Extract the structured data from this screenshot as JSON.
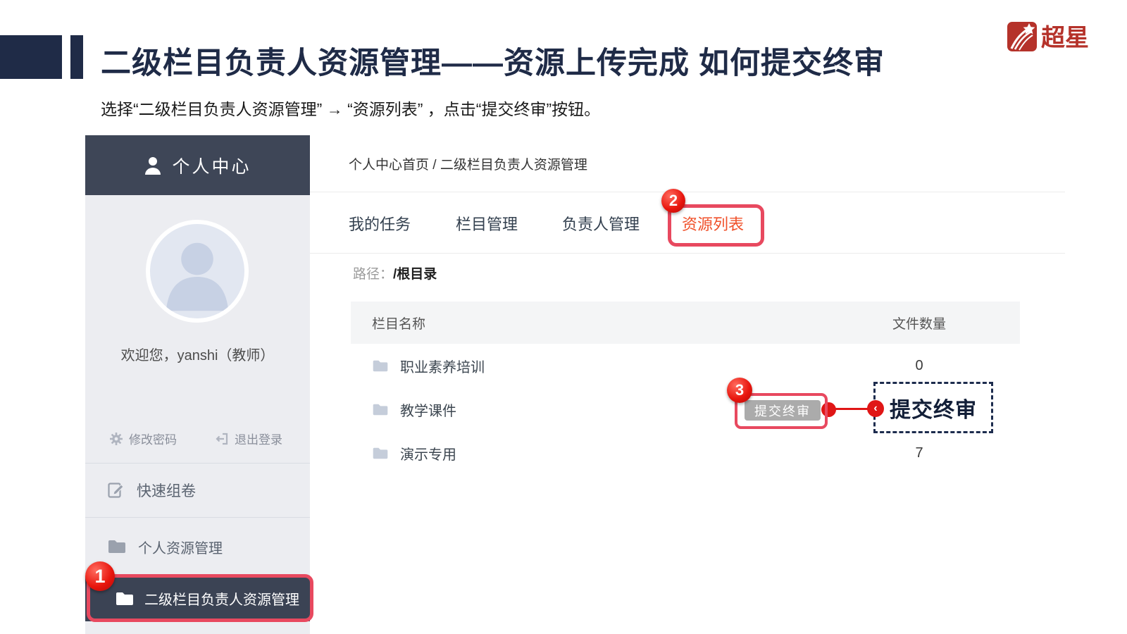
{
  "page": {
    "title": "二级栏目负责人资源管理——资源上传完成 如何提交终审",
    "subtitle": "选择“二级栏目负责人资源管理” → “资源列表” ，点击“提交终审”按钮。",
    "logo_text": "超星"
  },
  "colors": {
    "title_navy": "#1f2b47",
    "sidebar_dark": "#3e4657",
    "sidebar_bg": "#ecedf1",
    "highlight_red": "#e8495f",
    "badge_red": "#e8150d",
    "active_tab_orange": "#f0502a",
    "callout_navy": "#1d2c4e",
    "disabled_button_gray": "#ababab",
    "table_header_bg": "#f4f5f6"
  },
  "sidebar": {
    "header_title": "个人中心",
    "welcome": "欢迎您，yanshi（教师）",
    "account_actions": [
      {
        "label": "修改密码",
        "icon": "gear-icon"
      },
      {
        "label": "退出登录",
        "icon": "logout-icon"
      }
    ],
    "menu": [
      {
        "label": "快速组卷",
        "icon": "compose-icon"
      },
      {
        "label": "个人资源管理",
        "icon": "folder-icon"
      },
      {
        "label": "二级栏目负责人资源管理",
        "icon": "folder-icon",
        "active": true
      }
    ]
  },
  "content": {
    "breadcrumb": "个人中心首页 / 二级栏目负责人资源管理",
    "tabs": [
      {
        "label": "我的任务"
      },
      {
        "label": "栏目管理"
      },
      {
        "label": "负责人管理"
      },
      {
        "label": "资源列表",
        "active": true
      }
    ],
    "path_label": "路径：",
    "path_value": "/根目录",
    "table": {
      "columns": [
        "栏目名称",
        "文件数量"
      ],
      "rows": [
        {
          "name": "职业素养培训",
          "count": "0"
        },
        {
          "name": "教学课件",
          "count": "",
          "action_label": "提交终审"
        },
        {
          "name": "演示专用",
          "count": "7"
        }
      ]
    }
  },
  "annotations": {
    "steps": [
      "1",
      "2",
      "3"
    ],
    "callout_label": "提交终审",
    "chevron": "‹"
  }
}
